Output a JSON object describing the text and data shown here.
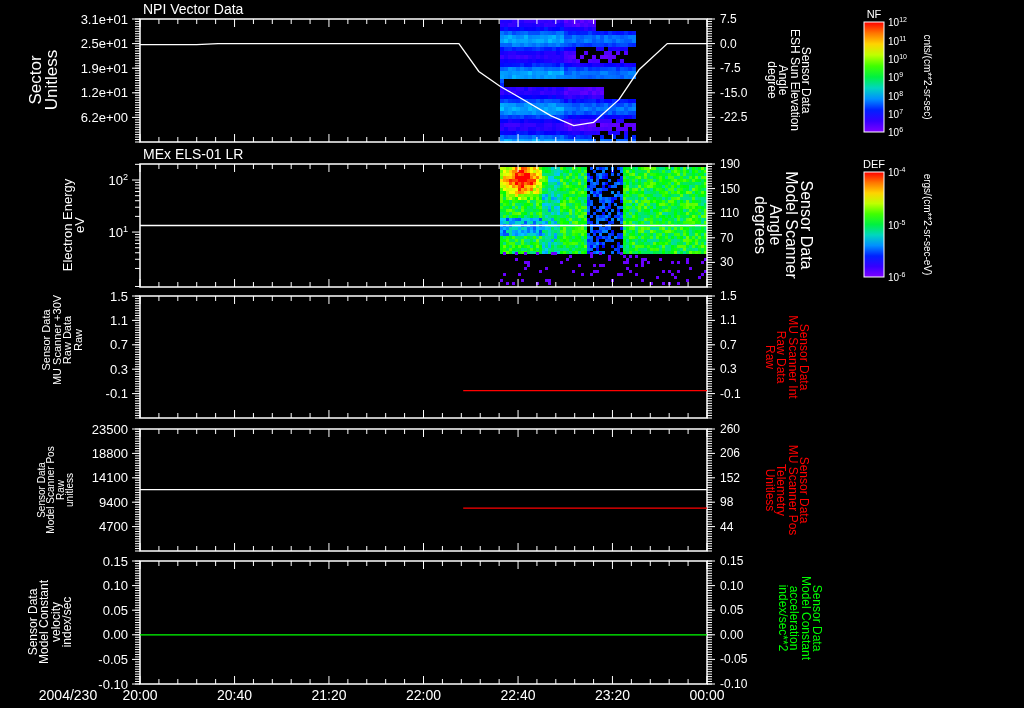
{
  "panels": [
    {
      "kind": "spectrogram",
      "title": "NPI Vector Data",
      "left_label": [
        "Sector",
        "Unitless"
      ],
      "right_label": {
        "lines": [
          "Sensor Data",
          "ESH Sun Elevation",
          "Angle",
          "degree"
        ],
        "color": "#ffffff"
      },
      "colorbar": {
        "label": "NF",
        "ticks": [
          "10$^{12}$",
          "10$^{11}$",
          "10$^{10}$",
          "10$^{9}$",
          "10$^{8}$",
          "10$^{7}$",
          "10$^{6}$"
        ],
        "units": "cnts/(cm**2-sr-sec)"
      },
      "chart_data": {
        "type": "line",
        "xlim": [
          20,
          24
        ],
        "ylim": [
          0,
          31
        ],
        "yticks": [
          {
            "value": 31,
            "label": "3.1e+01"
          },
          {
            "value": 24.8,
            "label": "2.5e+01"
          },
          {
            "value": 18.6,
            "label": "1.9e+01"
          },
          {
            "value": 12.4,
            "label": "1.2e+01"
          },
          {
            "value": 6.2,
            "label": "6.2e+00"
          }
        ],
        "y2lim": [
          -30,
          7.5
        ],
        "y2ticks": [
          {
            "value": 7.5,
            "label": "7.5"
          },
          {
            "value": 0,
            "label": "0.0"
          },
          {
            "value": -7.5,
            "label": "-7.5"
          },
          {
            "value": -15,
            "label": "-15.0"
          },
          {
            "value": -22.5,
            "label": "-22.5"
          }
        ],
        "x": [
          20,
          20.4,
          20.55,
          22.25,
          22.39,
          22.54,
          22.62,
          22.9,
          23.06,
          23.2,
          23.38,
          23.52,
          23.72,
          24
        ],
        "series": [
          {
            "color": "#ffffff",
            "axis": "y2",
            "values": [
              -0.3,
              -0.3,
              0,
              0,
              -8.5,
              -13,
              -15,
              -22,
              -25,
              -24,
              -17,
              -8,
              0,
              0
            ]
          }
        ]
      }
    },
    {
      "kind": "spectrogram",
      "title": "MEx ELS-01 LR",
      "left_label": [
        "Electron Energy",
        "eV"
      ],
      "energy_axis_labels": [
        "10$^{2}$",
        "10$^{1}$"
      ],
      "right_label": {
        "lines": [
          "Sensor Data",
          "Model Scanner",
          "Angle",
          "degrees"
        ],
        "color": "#ffffff"
      },
      "colorbar": {
        "label": "DEF",
        "ticks": [
          "10$^{-4}$",
          "10$^{-5}$",
          "10$^{-6}$"
        ],
        "units": "ergs/(cm**2-sr-sec-eV)"
      },
      "chart_data": {
        "type": "line",
        "xlim": [
          20,
          24
        ],
        "y2lim": [
          -10,
          190
        ],
        "y2ticks": [
          {
            "value": 190,
            "label": "190"
          },
          {
            "value": 150,
            "label": "150"
          },
          {
            "value": 110,
            "label": "110"
          },
          {
            "value": 70,
            "label": "70"
          },
          {
            "value": 30,
            "label": "30"
          }
        ],
        "x": [
          20,
          24
        ],
        "series": [
          {
            "color": "#ffffff",
            "axis": "y2",
            "values": [
              90,
              90
            ]
          }
        ]
      }
    },
    {
      "kind": "line",
      "left_label": [
        "Sensor Data",
        "MU Scanner +30V",
        "Raw Data",
        "Raw"
      ],
      "right_label": {
        "lines": [
          "Sensor Data",
          "MU Scanner Int",
          "Raw Data",
          "Raw"
        ],
        "color": "#ff0000"
      },
      "chart_data": {
        "type": "line",
        "xlim": [
          20,
          24
        ],
        "ylim": [
          -0.5,
          1.5
        ],
        "yticks": [
          {
            "value": 1.5,
            "label": "1.5"
          },
          {
            "value": 1.1,
            "label": "1.1"
          },
          {
            "value": 0.7,
            "label": "0.7"
          },
          {
            "value": 0.3,
            "label": "0.3"
          },
          {
            "value": -0.1,
            "label": "-0.1"
          }
        ],
        "y2lim": [
          -0.5,
          1.5
        ],
        "y2ticks": [
          {
            "value": 1.5,
            "label": "1.5"
          },
          {
            "value": 1.1,
            "label": "1.1"
          },
          {
            "value": 0.7,
            "label": "0.7"
          },
          {
            "value": 0.3,
            "label": "0.3"
          },
          {
            "value": -0.1,
            "label": "-0.1"
          }
        ],
        "x": [
          22.28,
          24
        ],
        "series": [
          {
            "color": "#ff0000",
            "axis": "y2",
            "values": [
              -0.05,
              -0.05
            ]
          }
        ]
      }
    },
    {
      "kind": "line",
      "left_label": [
        "Sensor Data",
        "Model Scanner Pos",
        "Raw",
        "unitless"
      ],
      "right_label": {
        "lines": [
          "Sensor Data",
          "MU Scanner Pos",
          "Telemetry",
          "Unitless"
        ],
        "color": "#ff0000"
      },
      "chart_data": {
        "type": "line",
        "xlim": [
          20,
          24
        ],
        "ylim": [
          0,
          23500
        ],
        "yticks": [
          {
            "value": 23500,
            "label": "23500"
          },
          {
            "value": 18800,
            "label": "18800"
          },
          {
            "value": 14100,
            "label": "14100"
          },
          {
            "value": 9400,
            "label": "9400"
          },
          {
            "value": 4700,
            "label": "4700"
          }
        ],
        "y2lim": [
          -10,
          260
        ],
        "y2ticks": [
          {
            "value": 260,
            "label": "260"
          },
          {
            "value": 206,
            "label": "206"
          },
          {
            "value": 152,
            "label": "152"
          },
          {
            "value": 98,
            "label": "98"
          },
          {
            "value": 44,
            "label": "44"
          }
        ],
        "x": [
          20,
          22.28,
          24
        ],
        "series": [
          {
            "color": "#ffffff",
            "values": [
              11800,
              11800,
              11800
            ]
          },
          {
            "color": "#ff0000",
            "axis": "y2",
            "values": [
              null,
              85,
              85
            ]
          }
        ]
      }
    },
    {
      "kind": "line",
      "left_label": [
        "Sensor Data",
        "Model Constant",
        "velocity",
        "index/sec"
      ],
      "right_label": {
        "lines": [
          "Sensor Data",
          "Model Constant",
          "acceleration",
          "index/sec**2"
        ],
        "color": "#00ff00"
      },
      "chart_data": {
        "type": "line",
        "xlim": [
          20,
          24
        ],
        "xticks": [
          {
            "value": 20,
            "label": "20:00"
          },
          {
            "value": 20.667,
            "label": "20:40"
          },
          {
            "value": 21.333,
            "label": "21:20"
          },
          {
            "value": 22,
            "label": "22:00"
          },
          {
            "value": 22.667,
            "label": "22:40"
          },
          {
            "value": 23.333,
            "label": "23:20"
          },
          {
            "value": 24,
            "label": "00:00"
          }
        ],
        "ylim": [
          -0.1,
          0.15
        ],
        "yticks": [
          {
            "value": 0.15,
            "label": "0.15"
          },
          {
            "value": 0.1,
            "label": "0.10"
          },
          {
            "value": 0.05,
            "label": "0.05"
          },
          {
            "value": 0,
            "label": "0.00"
          },
          {
            "value": -0.05,
            "label": "-0.05"
          },
          {
            "value": -0.1,
            "label": "-0.10"
          }
        ],
        "y2lim": [
          -0.1,
          0.15
        ],
        "y2ticks": [
          {
            "value": 0.15,
            "label": "0.15"
          },
          {
            "value": 0.1,
            "label": "0.10"
          },
          {
            "value": 0.05,
            "label": "0.05"
          },
          {
            "value": 0,
            "label": "0.00"
          },
          {
            "value": -0.05,
            "label": "-0.05"
          },
          {
            "value": -0.1,
            "label": "-0.10"
          }
        ],
        "x": [
          20,
          24
        ],
        "series": [
          {
            "color": "#00ff00",
            "axis": "y2",
            "values": [
              0,
              0
            ]
          }
        ]
      }
    }
  ],
  "date": "2004/230"
}
